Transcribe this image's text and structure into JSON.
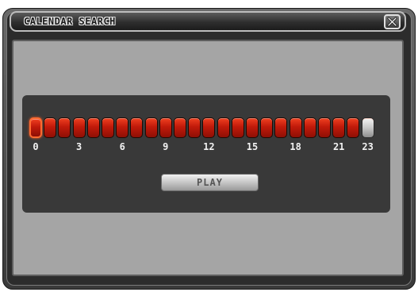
{
  "dialog": {
    "title": "CALENDAR SEARCH",
    "close_label": "X"
  },
  "timeline": {
    "hours": [
      0,
      1,
      2,
      3,
      4,
      5,
      6,
      7,
      8,
      9,
      10,
      11,
      12,
      13,
      14,
      15,
      16,
      17,
      18,
      19,
      20,
      21,
      22,
      23
    ],
    "hours_with_recording": [
      0,
      1,
      2,
      3,
      4,
      5,
      6,
      7,
      8,
      9,
      10,
      11,
      12,
      13,
      14,
      15,
      16,
      17,
      18,
      19,
      20,
      21,
      22
    ],
    "selected_hour": 0,
    "tick_labels": [
      "0",
      "3",
      "6",
      "9",
      "12",
      "15",
      "18",
      "21",
      "23"
    ],
    "recorded_color": "#c11a0a",
    "empty_color": "#c8c8c8"
  },
  "actions": {
    "play_label": "PLAY"
  }
}
